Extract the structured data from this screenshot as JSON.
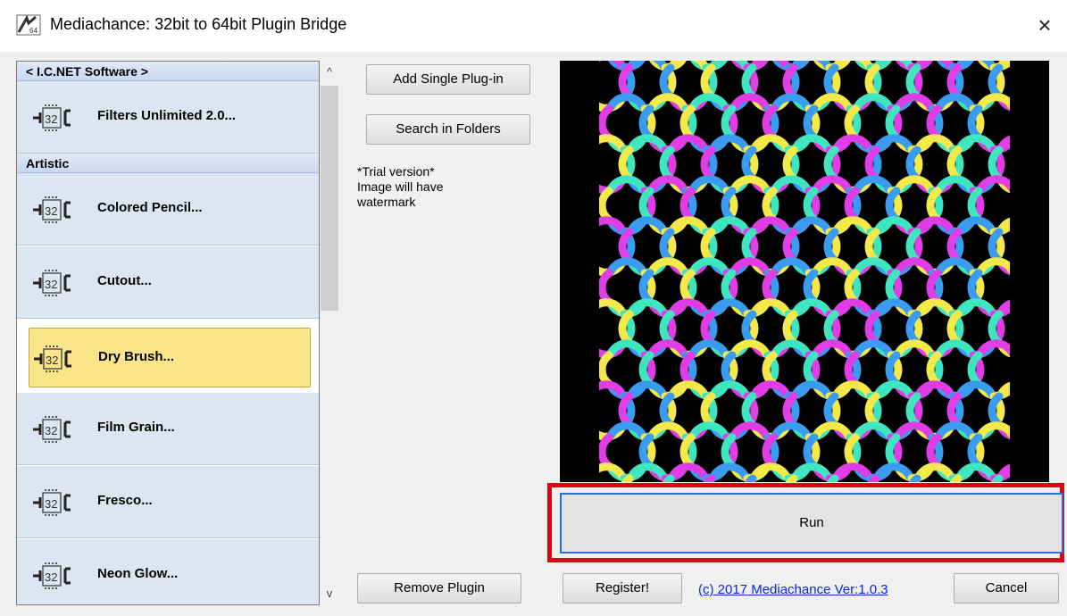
{
  "window": {
    "title": "Mediachance: 32bit to 64bit Plugin Bridge",
    "close_glyph": "×",
    "app_icon": "plugin-bridge-app-icon"
  },
  "plugin_list": {
    "categories": [
      {
        "name": "< I.C.NET Software >",
        "items": [
          {
            "label": "Filters Unlimited 2.0...",
            "badge": "32",
            "selected": false
          }
        ]
      },
      {
        "name": "Artistic",
        "items": [
          {
            "label": "Colored Pencil...",
            "badge": "32",
            "selected": false
          },
          {
            "label": "Cutout...",
            "badge": "32",
            "selected": false
          },
          {
            "label": "Dry Brush...",
            "badge": "32",
            "selected": true
          },
          {
            "label": "Film Grain...",
            "badge": "32",
            "selected": false
          },
          {
            "label": "Fresco...",
            "badge": "32",
            "selected": false
          },
          {
            "label": "Neon Glow...",
            "badge": "32",
            "selected": false
          }
        ]
      }
    ],
    "scroll_up_glyph": "^",
    "scroll_down_glyph": "v",
    "icon": "32bit-plugin-chip-icon"
  },
  "buttons": {
    "add_single_plugin": "Add Single Plug-in",
    "search_in_folders": "Search in Folders",
    "remove_plugin": "Remove Plugin",
    "register": "Register!",
    "cancel": "Cancel",
    "run": "Run"
  },
  "trial_note": {
    "lines": [
      "*Trial version*",
      "Image will have",
      "watermark"
    ]
  },
  "footer": {
    "copyright_link": "(c) 2017 Mediachance Ver:1.0.3"
  },
  "preview": {
    "pattern_colors": [
      "#e03de6",
      "#3a9cf0",
      "#f5e94a",
      "#3ee6c0"
    ],
    "background": "#000000"
  },
  "colors": {
    "selection_highlight": "#fbe58b",
    "list_item_bg": "#dce6f2",
    "run_focus_border": "#2c6fcf",
    "annotation_red": "#e10010",
    "link_blue": "#0a26e8"
  }
}
